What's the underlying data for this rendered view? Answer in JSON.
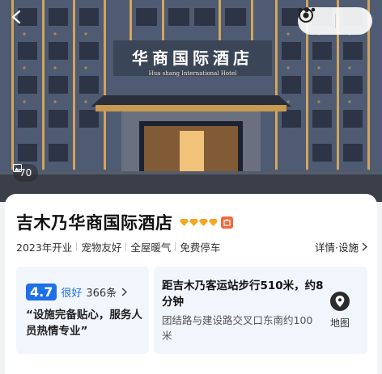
{
  "hero": {
    "sign_cn": "华商国际酒店",
    "sign_en": "Hua shang International Hotel",
    "photo_count": "70",
    "icons": {
      "back": "back-arrow-icon",
      "more": "more-dots-icon",
      "close": "target-circle-icon",
      "photos": "image-icon"
    }
  },
  "hotel": {
    "name": "吉木乃华商国际酒店",
    "diamond_count": 4,
    "tags": [
      "2023年开业",
      "宠物友好",
      "全屋暖气",
      "免费停车"
    ],
    "detail_link": "详情·设施",
    "colors": {
      "diamond": "#f5a623",
      "badge": "#f06a3a",
      "accent": "#1f6fe8",
      "panel": "#f1f5fc"
    }
  },
  "rating": {
    "score": "4.7",
    "word": "很好",
    "count": "366条",
    "quote": "“设施完备贴心，服务人员热情专业”"
  },
  "location": {
    "distance": "距吉木乃客运站步行510米，约8分钟",
    "address": "团结路与建设路交叉口东南约100米",
    "map_label": "地图",
    "map_icon": "location-pin-icon"
  }
}
